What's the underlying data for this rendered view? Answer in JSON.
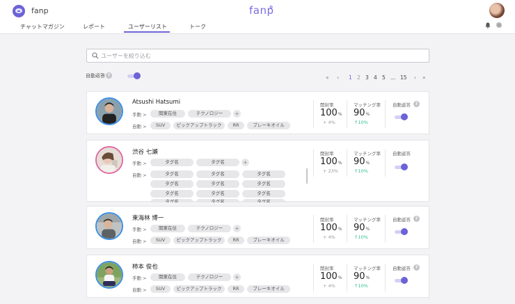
{
  "header": {
    "app_name": "fanp",
    "brand": "fanp",
    "tabs": [
      "チャットマガジン",
      "レポート",
      "ユーザーリスト",
      "トーク"
    ]
  },
  "search": {
    "placeholder": "ユーザーを絞り込む"
  },
  "auto_reply": {
    "label": "自動返答",
    "help": "?",
    "enabled": true
  },
  "pagination": {
    "first": "«",
    "prev": "‹",
    "next": "›",
    "last": "»",
    "pages": [
      "1",
      "2",
      "3",
      "4",
      "5",
      "...",
      "15"
    ],
    "current": "1"
  },
  "users": [
    {
      "name": "Atsushi Hatsumi",
      "manual_label": "手動",
      "auto_label": "自動",
      "manual_tags": [
        "関東在住",
        "テクノロジー"
      ],
      "auto_tags": [
        "SUV",
        "ピックアップトラック",
        "RR",
        "ブレーキオイル"
      ],
      "open_rate": {
        "label": "開封率",
        "value": "100",
        "unit": "%",
        "delta": "+ 4%"
      },
      "match_rate": {
        "label": "マッチング率",
        "value": "90",
        "unit": "%",
        "delta": "↑10%"
      },
      "auto_reply": {
        "label": "自動返答",
        "help": "?"
      }
    },
    {
      "name": "渋谷 七瀬",
      "manual_label": "手動",
      "auto_label": "自動",
      "manual_tags": [
        "タグ名",
        "タグ名"
      ],
      "auto_tags": [
        "タグ名",
        "タグ名",
        "タグ名",
        "タグ名",
        "タグ名",
        "タグ名",
        "タグ名",
        "タグ名",
        "タグ名",
        "タグ名",
        "タグ名",
        "タグ名"
      ],
      "open_rate": {
        "label": "開封率",
        "value": "100",
        "unit": "%",
        "delta": "+ 23%"
      },
      "match_rate": {
        "label": "マッチング率",
        "value": "90",
        "unit": "%",
        "delta": "↑10%"
      },
      "auto_reply": {
        "label": "自動返答",
        "help": ""
      }
    },
    {
      "name": "東海林 博一",
      "manual_label": "手動",
      "auto_label": "自動",
      "manual_tags": [
        "関東在住",
        "テクノロジー"
      ],
      "auto_tags": [
        "SUV",
        "ピックアップトラック",
        "RR",
        "ブレーキオイル"
      ],
      "open_rate": {
        "label": "開封率",
        "value": "100",
        "unit": "%",
        "delta": "+ 4%"
      },
      "match_rate": {
        "label": "マッチング率",
        "value": "90",
        "unit": "%",
        "delta": "↑10%"
      },
      "auto_reply": {
        "label": "自動返答",
        "help": "?"
      }
    },
    {
      "name": "柿本 俊也",
      "manual_label": "手動",
      "auto_label": "自動",
      "manual_tags": [
        "関東在住",
        "テクノロジー"
      ],
      "auto_tags": [
        "SUV",
        "ピックアップトラック",
        "RR",
        "ブレーキオイル"
      ],
      "open_rate": {
        "label": "開封率",
        "value": "100",
        "unit": "%",
        "delta": "+ 4%"
      },
      "match_rate": {
        "label": "マッチング率",
        "value": "90",
        "unit": "%",
        "delta": "↑10%"
      },
      "auto_reply": {
        "label": "自動返答",
        "help": "?"
      }
    }
  ]
}
